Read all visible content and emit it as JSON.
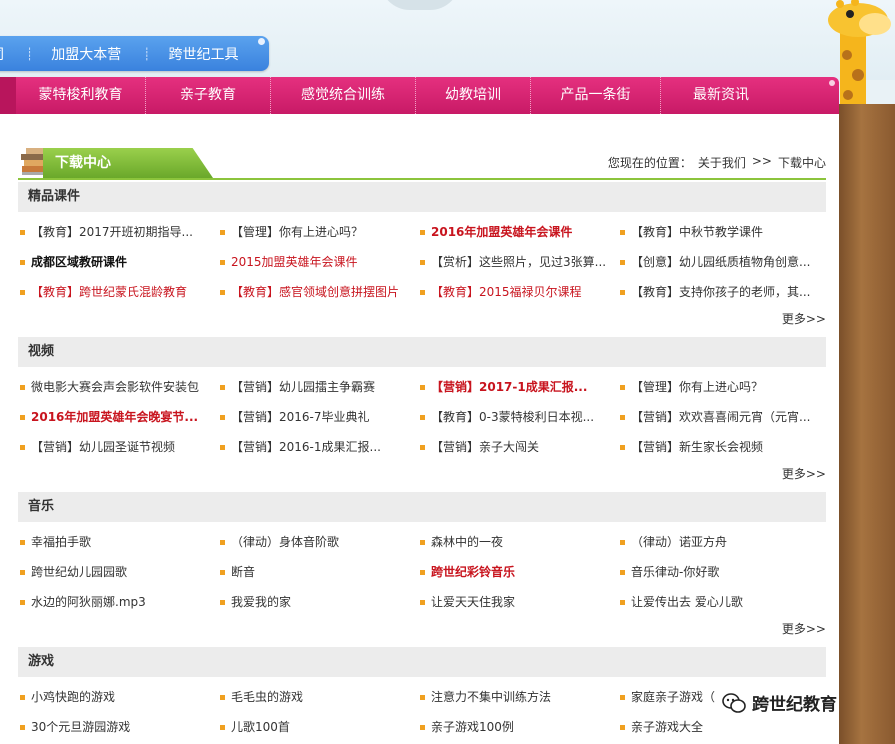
{
  "top_nav": {
    "items": [
      "同",
      "加盟大本营",
      "跨世纪工具"
    ]
  },
  "main_nav": {
    "items": [
      "蒙特梭利教育",
      "亲子教育",
      "感觉统合训练",
      "幼教培训",
      "产品一条街",
      "最新资讯"
    ]
  },
  "page": {
    "title": "下载中心",
    "breadcrumb_prefix": "您现在的位置：",
    "breadcrumb_1": "关于我们",
    "breadcrumb_sep": ">>",
    "breadcrumb_2": "下载中心"
  },
  "colors": {
    "pink_nav": "#d8226f",
    "blue_nav": "#4a92e6",
    "accent_green": "#8cc43c",
    "link_red": "#c8141e",
    "bullet": "#f0a020"
  },
  "sections": [
    {
      "title": "精品课件",
      "more": "更多>>",
      "items": [
        {
          "text": "【教育】2017开班初期指导...",
          "style": "normal"
        },
        {
          "text": "【管理】你有上进心吗？",
          "style": "normal"
        },
        {
          "text": "2016年加盟英雄年会课件",
          "style": "redbold"
        },
        {
          "text": "【教育】中秋节教学课件",
          "style": "normal"
        },
        {
          "text": "成都区域教研课件",
          "style": "boldblack"
        },
        {
          "text": "2015加盟英雄年会课件",
          "style": "red"
        },
        {
          "text": "【赏析】这些照片，见过3张算...",
          "style": "normal"
        },
        {
          "text": "【创意】幼儿园纸质植物角创意...",
          "style": "normal"
        },
        {
          "text": "【教育】跨世纪蒙氏混龄教育",
          "style": "red"
        },
        {
          "text": "【教育】感官领域创意拼摆图片",
          "style": "red"
        },
        {
          "text": "【教育】2015福禄贝尔课程",
          "style": "red"
        },
        {
          "text": "【教育】支持你孩子的老师，其...",
          "style": "normal"
        }
      ]
    },
    {
      "title": "视频",
      "more": "更多>>",
      "items": [
        {
          "text": "微电影大赛会声会影软件安装包",
          "style": "normal"
        },
        {
          "text": "【营销】幼儿园擂主争霸赛",
          "style": "normal"
        },
        {
          "text": "【营销】2017-1成果汇报...",
          "style": "redbold"
        },
        {
          "text": "【管理】你有上进心吗？",
          "style": "normal"
        },
        {
          "text": "2016年加盟英雄年会晚宴节...",
          "style": "redbold"
        },
        {
          "text": "【营销】2016-7毕业典礼",
          "style": "normal"
        },
        {
          "text": "【教育】0-3蒙特梭利日本视...",
          "style": "normal"
        },
        {
          "text": "【营销】欢欢喜喜闹元宵（元宵...",
          "style": "normal"
        },
        {
          "text": "【营销】幼儿园圣诞节视频",
          "style": "normal"
        },
        {
          "text": "【营销】2016-1成果汇报...",
          "style": "normal"
        },
        {
          "text": "【营销】亲子大闯关",
          "style": "normal"
        },
        {
          "text": "【营销】新生家长会视频",
          "style": "normal"
        }
      ]
    },
    {
      "title": "音乐",
      "more": "更多>>",
      "items": [
        {
          "text": "幸福拍手歌",
          "style": "normal"
        },
        {
          "text": "（律动）身体音阶歌",
          "style": "normal"
        },
        {
          "text": "森林中的一夜",
          "style": "normal"
        },
        {
          "text": "（律动）诺亚方舟",
          "style": "normal"
        },
        {
          "text": "跨世纪幼儿园园歌",
          "style": "normal"
        },
        {
          "text": "断音",
          "style": "normal"
        },
        {
          "text": "跨世纪彩铃音乐",
          "style": "redbold"
        },
        {
          "text": "音乐律动-你好歌",
          "style": "normal"
        },
        {
          "text": "水边的阿狄丽娜.mp3",
          "style": "normal"
        },
        {
          "text": "我爱我的家",
          "style": "normal"
        },
        {
          "text": "让爱天天住我家",
          "style": "normal"
        },
        {
          "text": "让爱传出去 爱心儿歌",
          "style": "normal"
        }
      ]
    },
    {
      "title": "游戏",
      "more": "",
      "items": [
        {
          "text": "小鸡快跑的游戏",
          "style": "normal"
        },
        {
          "text": "毛毛虫的游戏",
          "style": "normal"
        },
        {
          "text": "注意力不集中训练方法",
          "style": "normal"
        },
        {
          "text": "家庭亲子游戏（",
          "style": "normal"
        },
        {
          "text": "30个元旦游园游戏",
          "style": "normal"
        },
        {
          "text": "儿歌100首",
          "style": "normal"
        },
        {
          "text": "亲子游戏100例",
          "style": "normal"
        },
        {
          "text": "亲子游戏大全",
          "style": "normal"
        }
      ]
    }
  ],
  "watermark": {
    "text": "跨世纪教育"
  }
}
